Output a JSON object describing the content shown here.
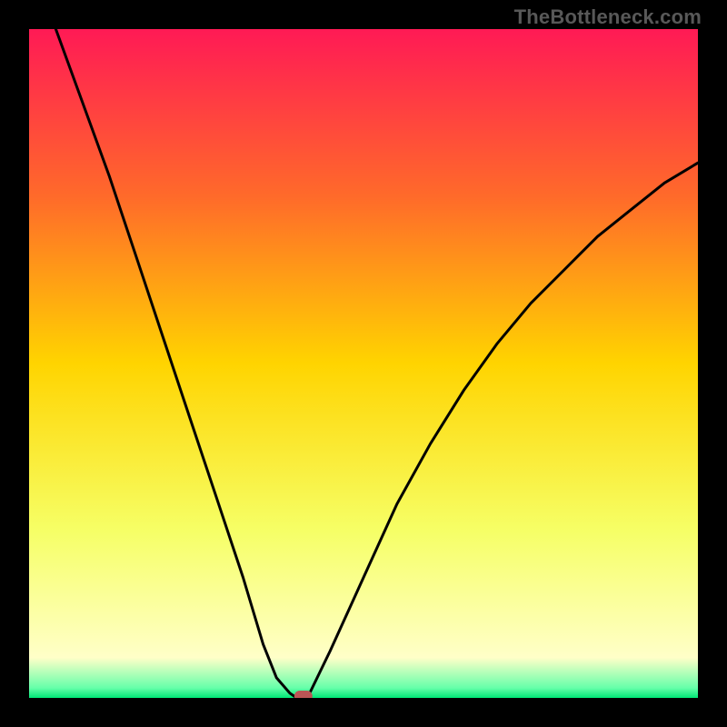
{
  "watermark": "TheBottleneck.com",
  "chart_data": {
    "type": "line",
    "title": "",
    "xlabel": "",
    "ylabel": "",
    "xlim": [
      0,
      100
    ],
    "ylim": [
      0,
      100
    ],
    "gradient_stops": [
      {
        "offset": 0.0,
        "color": "#ff1a55"
      },
      {
        "offset": 0.25,
        "color": "#ff6a2a"
      },
      {
        "offset": 0.5,
        "color": "#ffd400"
      },
      {
        "offset": 0.75,
        "color": "#f6ff66"
      },
      {
        "offset": 0.94,
        "color": "#ffffc8"
      },
      {
        "offset": 0.985,
        "color": "#66ffaa"
      },
      {
        "offset": 1.0,
        "color": "#00e676"
      }
    ],
    "series": [
      {
        "name": "bottleneck-curve",
        "color": "#000000",
        "x": [
          4,
          8,
          12,
          16,
          20,
          24,
          28,
          32,
          35,
          37,
          39,
          40,
          41,
          42,
          45,
          50,
          55,
          60,
          65,
          70,
          75,
          80,
          85,
          90,
          95,
          100
        ],
        "y": [
          100,
          89,
          78,
          66,
          54,
          42,
          30,
          18,
          8,
          3,
          0.7,
          0,
          0,
          0.8,
          7,
          18,
          29,
          38,
          46,
          53,
          59,
          64,
          69,
          73,
          77,
          80
        ]
      }
    ],
    "marker": {
      "x": 41,
      "y": 0,
      "color": "#bb5555"
    }
  }
}
